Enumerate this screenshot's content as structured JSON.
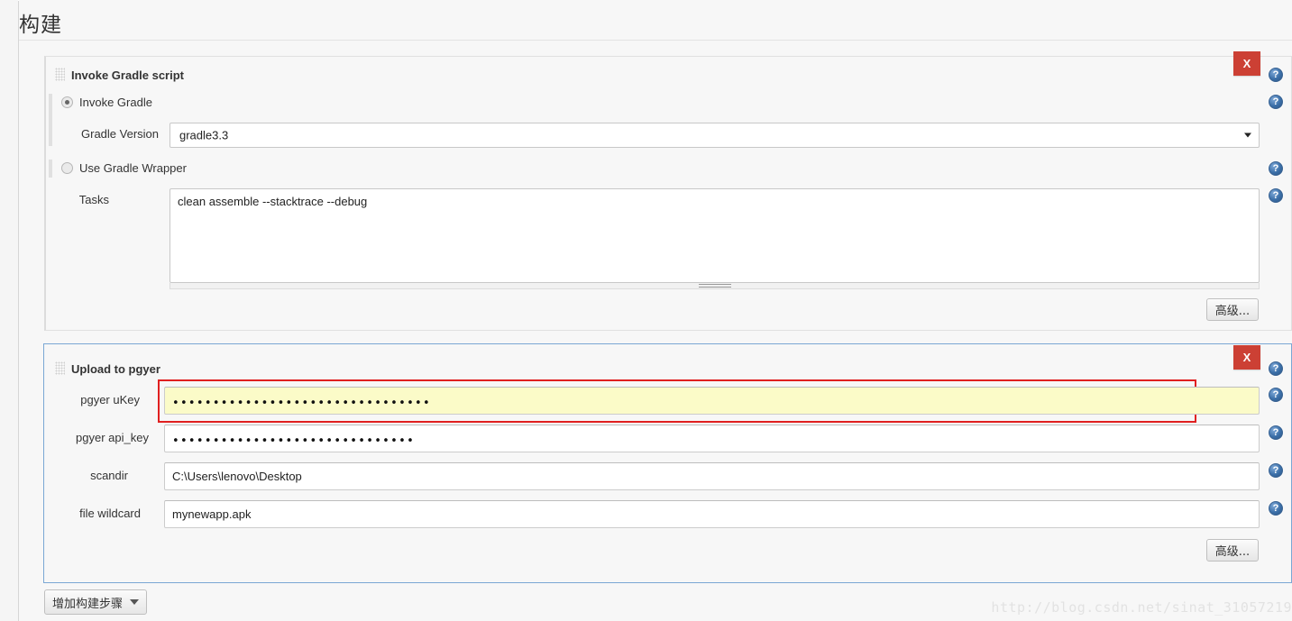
{
  "page": {
    "title": "构建",
    "watermark": "http://blog.csdn.net/sinat_31057219",
    "colors": {
      "close_red": "#cc4034",
      "help_blue": "#3b6fa8",
      "focus_border": "#7aa7d4",
      "error_border": "#e02020",
      "warn_field_bg": "#fbfbc8",
      "page_bg": "#f7f7f7"
    }
  },
  "blocks": [
    {
      "title": "Invoke Gradle script",
      "close_label": "X",
      "help_label": "?",
      "radios": [
        {
          "label": "Invoke Gradle",
          "selected": true
        },
        {
          "label": "Use Gradle Wrapper",
          "selected": false
        }
      ],
      "gradle_version": {
        "label": "Gradle Version",
        "value": "gradle3.3",
        "options": [
          "gradle3.3"
        ]
      },
      "tasks": {
        "label": "Tasks",
        "value": "clean assemble --stacktrace --debug",
        "placeholder": ""
      },
      "advanced_label": "高级..."
    },
    {
      "title": "Upload to pgyer",
      "close_label": "X",
      "help_label": "?",
      "fields": [
        {
          "label": "pgyer uKey",
          "value": "••••••••••••••••••••••••••••••••",
          "masked": true,
          "error": true,
          "warn": true
        },
        {
          "label": "pgyer api_key",
          "value": "••••••••••••••••••••••••••••••",
          "masked": true,
          "error": false,
          "warn": false
        },
        {
          "label": "scandir",
          "value": "C:\\Users\\lenovo\\Desktop",
          "masked": false,
          "error": false,
          "warn": false
        },
        {
          "label": "file wildcard",
          "value": "mynewapp.apk",
          "masked": false,
          "error": false,
          "warn": false
        }
      ],
      "advanced_label": "高级..."
    }
  ],
  "footer": {
    "add_build_step_label": "增加构建步骤"
  }
}
